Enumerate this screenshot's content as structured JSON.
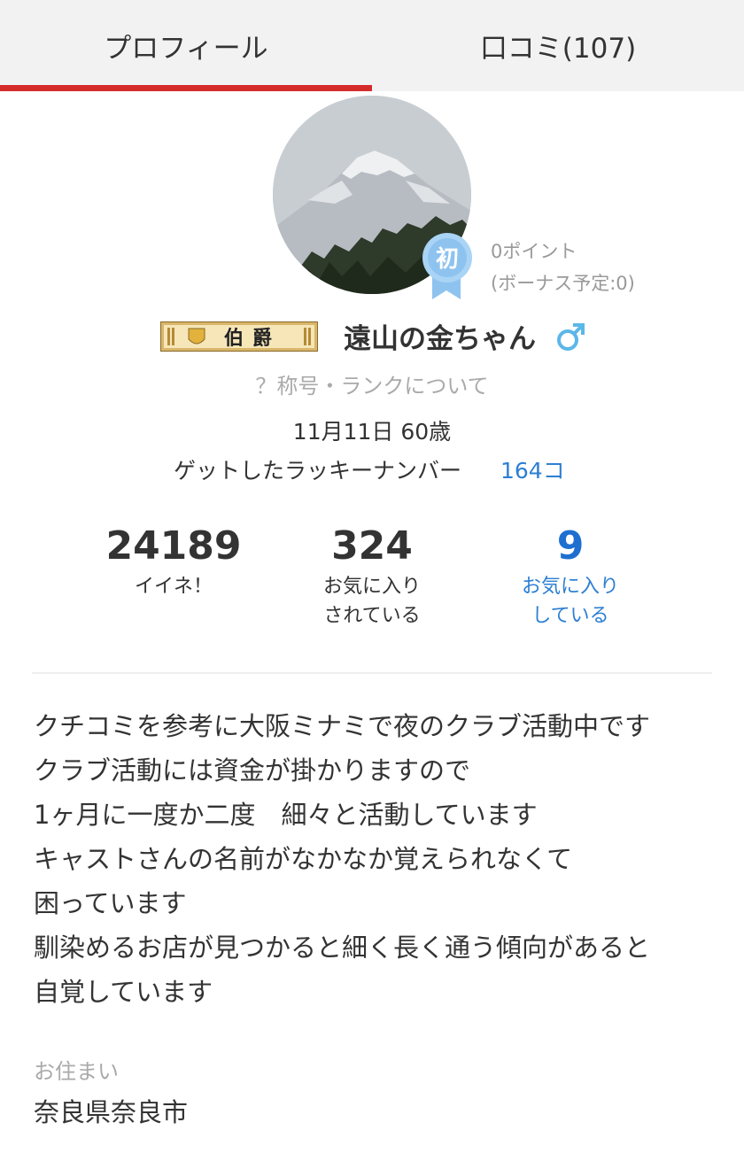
{
  "tabs": [
    {
      "label": "プロフィール",
      "active": true
    },
    {
      "label": "口コミ(107)",
      "active": false
    }
  ],
  "badge": {
    "first_char": "初"
  },
  "points": {
    "line1": "0ポイント",
    "line2": "(ボーナス予定:0)"
  },
  "rank": {
    "title": "伯爵"
  },
  "user": {
    "name": "遠山の金ちゃん",
    "gender_symbol": "♂"
  },
  "rank_link": "？称号・ランクについて",
  "birthday": "11月11日 60歳",
  "lucky": {
    "label": "ゲットしたラッキーナンバー",
    "count": "164コ"
  },
  "stats": [
    {
      "value": "24189",
      "label1": "イイネ！",
      "label2": ""
    },
    {
      "value": "324",
      "label1": "お気に入り",
      "label2": "されている"
    },
    {
      "value": "9",
      "label1": "お気に入り",
      "label2": "している"
    }
  ],
  "bio": [
    "クチコミを参考に大阪ミナミで夜のクラブ活動中です",
    "クラブ活動には資金が掛かりますので",
    "1ヶ月に一度か二度　細々と活動しています",
    "キャストさんの名前がなかなか覚えられなくて",
    "困っています",
    "馴染めるお店が見つかると細く長く通う傾向があると",
    "自覚しています"
  ],
  "residence": {
    "label": "お住まい",
    "value": "奈良県奈良市"
  },
  "colors": {
    "accent_red": "#d42b2b",
    "link_blue": "#2d7fd3",
    "muted": "#aaaaaa"
  }
}
